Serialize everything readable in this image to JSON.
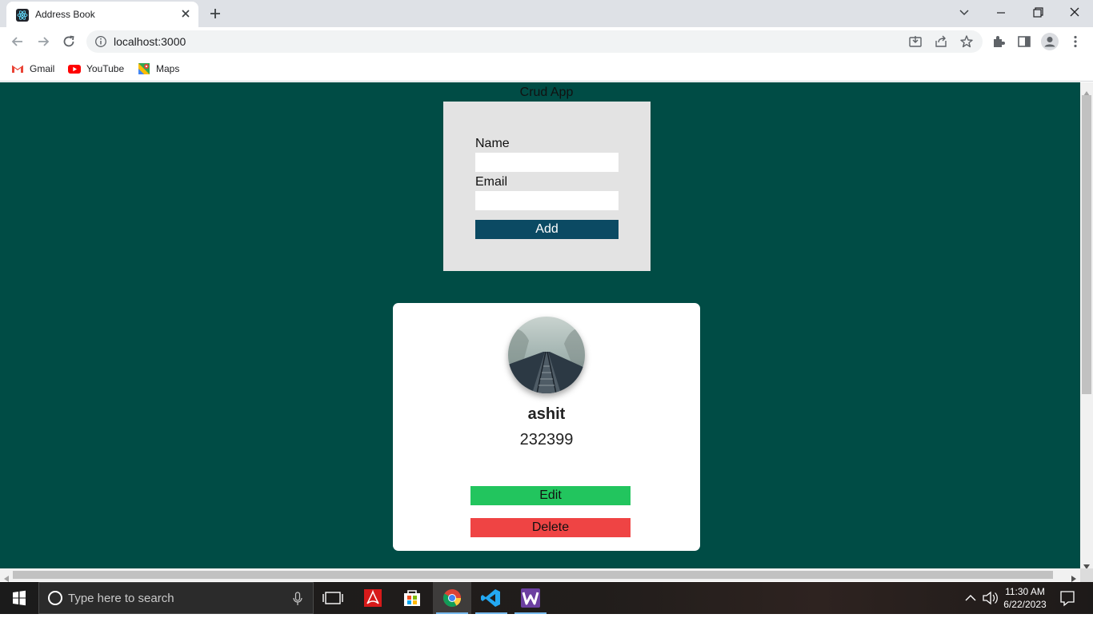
{
  "browser": {
    "tab_title": "Address Book",
    "url": "localhost:3000",
    "bookmarks": [
      {
        "label": "Gmail"
      },
      {
        "label": "YouTube"
      },
      {
        "label": "Maps"
      }
    ]
  },
  "app": {
    "title": "Crud App",
    "form": {
      "name_label": "Name",
      "name_value": "",
      "email_label": "Email",
      "email_value": "",
      "add_label": "Add"
    },
    "contact": {
      "name": "ashit",
      "phone": "232399",
      "edit_label": "Edit",
      "delete_label": "Delete"
    }
  },
  "taskbar": {
    "search_placeholder": "Type here to search",
    "time": "11:30 AM",
    "date": "6/22/2023"
  },
  "colors": {
    "page_background": "#004c45",
    "add_button": "#0b4a63",
    "edit_button": "#22c55e",
    "delete_button": "#ef4444"
  }
}
